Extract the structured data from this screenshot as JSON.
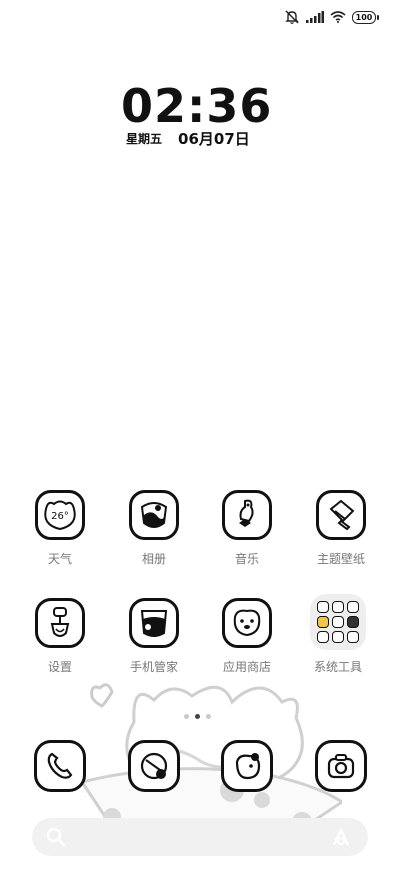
{
  "status_bar": {
    "icons": [
      "mute-bell-icon",
      "signal-icon",
      "wifi-icon"
    ],
    "battery": "100"
  },
  "clock": {
    "time": "02:36",
    "weekday": "星期五",
    "date": "06月07日"
  },
  "apps_row1": [
    {
      "label": "天气",
      "icon": "weather-icon",
      "text": "26°"
    },
    {
      "label": "相册",
      "icon": "gallery-icon"
    },
    {
      "label": "音乐",
      "icon": "music-icon"
    },
    {
      "label": "主题壁纸",
      "icon": "themes-icon"
    }
  ],
  "apps_row2": [
    {
      "label": "设置",
      "icon": "settings-icon"
    },
    {
      "label": "手机管家",
      "icon": "security-icon"
    },
    {
      "label": "应用商店",
      "icon": "app-store-icon"
    },
    {
      "label": "系统工具",
      "icon": "folder-icon"
    }
  ],
  "dock": [
    {
      "icon": "phone-icon"
    },
    {
      "icon": "messages-icon"
    },
    {
      "icon": "browser-icon"
    },
    {
      "icon": "camera-icon"
    }
  ],
  "page_indicator": {
    "count": 3,
    "active": 2
  },
  "search_bar": {
    "left_icon": "search-icon",
    "right_icon": "assistant-icon"
  }
}
